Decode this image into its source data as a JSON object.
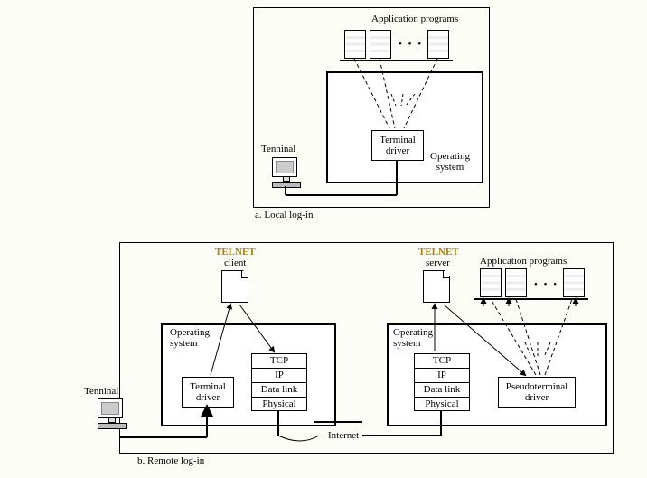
{
  "local": {
    "caption": "a. Local log-in",
    "apps_label": "Application programs",
    "terminal_driver": "Terminal\ndriver",
    "os_label": "Operating\nsystem",
    "terminal_label": "Tenninal"
  },
  "remote": {
    "caption": "b. Remote log-in",
    "internet": "Internet",
    "client": {
      "telnet": "TELNET",
      "sub": "client",
      "os_label": "Operating\nsystem",
      "terminal_label": "Tenninal",
      "terminal_driver": "Terminal\ndriver",
      "stack": [
        "TCP",
        "IP",
        "Data link",
        "Physical"
      ]
    },
    "server": {
      "telnet": "TELNET",
      "sub": "server",
      "os_label": "Operating\nsystem",
      "apps_label": "Application programs",
      "pseudo_driver": "Pseudoterminal\ndriver",
      "stack": [
        "TCP",
        "IP",
        "Data link",
        "Physical"
      ]
    }
  }
}
